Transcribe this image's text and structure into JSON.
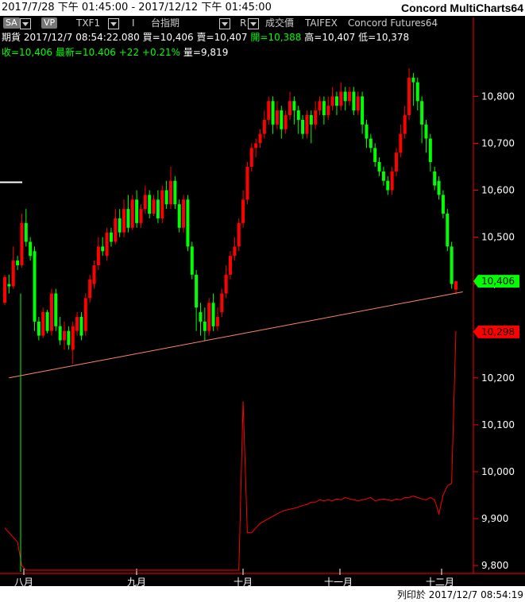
{
  "window": {
    "date_range": "2017/7/28 下午 01:45:00 - 2017/12/12 下午 01:45:00",
    "brand": "Concord MultiCharts64"
  },
  "toolbar": {
    "sa_label": "SA",
    "vp_label": "VP",
    "symbol": "TXF1",
    "interval_label": "I",
    "index_name": "台指期",
    "r_label": "R",
    "price_type": "成交價",
    "exchange": "TAIFEX",
    "feed": "Concord Futures64"
  },
  "quote": {
    "category": "期貨",
    "timestamp": "2017/12/7  08:54:22.080",
    "bid": "買=10,406",
    "ask": "賣=10,407",
    "open": "開=10,388",
    "high": "高=10,407",
    "low": "低=10,378",
    "close": "收=10,406",
    "last": "最新=10.406",
    "change": "+22",
    "change_pct": "+0.21%",
    "volume": "量=9,819"
  },
  "price_axis": {
    "ticks": [
      "10,800",
      "10,700",
      "10,600",
      "10,500",
      "10,400",
      "10,300",
      "10,200",
      "10,100",
      "10,000",
      "9,900",
      "9,800"
    ],
    "last_price_tag": "10,406",
    "second_tag": "10,298",
    "last_tag_color": "#00ff00",
    "second_tag_color": "#ff0000"
  },
  "time_axis": [
    "八月",
    "九月",
    "十月",
    "十一月",
    "十二月"
  ],
  "footer": {
    "printed": "列印於 2017/12/7 08:54:19"
  },
  "chart_data": {
    "type": "candlestick",
    "up_color": "#ff0000",
    "down_color": "#00ff00",
    "ylim": [
      9790,
      10870
    ],
    "candles": [
      [
        10360,
        10415,
        10355,
        10420
      ],
      [
        10400,
        10395,
        10380,
        10420
      ],
      [
        10395,
        10450,
        10390,
        10480
      ],
      [
        10450,
        10440,
        10430,
        10460
      ],
      [
        10440,
        10530,
        10435,
        10550
      ],
      [
        10530,
        10490,
        10480,
        10560
      ],
      [
        10490,
        10460,
        10450,
        10500
      ],
      [
        10470,
        10320,
        10300,
        10480
      ],
      [
        10320,
        10290,
        10280,
        10330
      ],
      [
        10290,
        10340,
        10285,
        10350
      ],
      [
        10340,
        10300,
        10295,
        10345
      ],
      [
        10300,
        10380,
        10290,
        10390
      ],
      [
        10380,
        10310,
        10300,
        10390
      ],
      [
        10310,
        10280,
        10270,
        10330
      ],
      [
        10280,
        10300,
        10260,
        10320
      ],
      [
        10300,
        10270,
        10260,
        10310
      ],
      [
        10260,
        10310,
        10230,
        10320
      ],
      [
        10300,
        10330,
        10290,
        10340
      ],
      [
        10330,
        10290,
        10280,
        10340
      ],
      [
        10300,
        10370,
        10290,
        10380
      ],
      [
        10370,
        10410,
        10360,
        10420
      ],
      [
        10400,
        10440,
        10390,
        10450
      ],
      [
        10440,
        10480,
        10430,
        10500
      ],
      [
        10480,
        10470,
        10460,
        10500
      ],
      [
        10460,
        10510,
        10450,
        10520
      ],
      [
        10510,
        10490,
        10480,
        10520
      ],
      [
        10490,
        10540,
        10485,
        10560
      ],
      [
        10540,
        10510,
        10500,
        10560
      ],
      [
        10510,
        10560,
        10500,
        10580
      ],
      [
        10560,
        10520,
        10510,
        10590
      ],
      [
        10520,
        10580,
        10515,
        10590
      ],
      [
        10580,
        10530,
        10520,
        10600
      ],
      [
        10530,
        10560,
        10520,
        10570
      ],
      [
        10560,
        10590,
        10550,
        10610
      ],
      [
        10590,
        10550,
        10540,
        10600
      ],
      [
        10550,
        10580,
        10545,
        10590
      ],
      [
        10580,
        10540,
        10530,
        10600
      ],
      [
        10540,
        10600,
        10530,
        10610
      ],
      [
        10600,
        10570,
        10560,
        10620
      ],
      [
        10570,
        10620,
        10560,
        10650
      ],
      [
        10620,
        10570,
        10560,
        10630
      ],
      [
        10570,
        10520,
        10510,
        10580
      ],
      [
        10520,
        10580,
        10510,
        10590
      ],
      [
        10580,
        10480,
        10470,
        10590
      ],
      [
        10480,
        10420,
        10410,
        10490
      ],
      [
        10420,
        10350,
        10300,
        10430
      ],
      [
        10340,
        10320,
        10290,
        10360
      ],
      [
        10320,
        10300,
        10280,
        10350
      ],
      [
        10300,
        10360,
        10290,
        10370
      ],
      [
        10360,
        10310,
        10300,
        10380
      ],
      [
        10310,
        10330,
        10300,
        10350
      ],
      [
        10340,
        10380,
        10330,
        10390
      ],
      [
        10380,
        10420,
        10370,
        10440
      ],
      [
        10420,
        10460,
        10410,
        10470
      ],
      [
        10460,
        10480,
        10450,
        10500
      ],
      [
        10480,
        10530,
        10470,
        10540
      ],
      [
        10530,
        10580,
        10520,
        10600
      ],
      [
        10580,
        10650,
        10570,
        10660
      ],
      [
        10650,
        10690,
        10640,
        10700
      ],
      [
        10690,
        10700,
        10670,
        10710
      ],
      [
        10700,
        10720,
        10690,
        10730
      ],
      [
        10720,
        10750,
        10710,
        10770
      ],
      [
        10750,
        10790,
        10740,
        10800
      ],
      [
        10790,
        10740,
        10720,
        10800
      ],
      [
        10740,
        10770,
        10730,
        10790
      ],
      [
        10770,
        10730,
        10710,
        10780
      ],
      [
        10730,
        10760,
        10720,
        10770
      ],
      [
        10760,
        10790,
        10750,
        10810
      ],
      [
        10790,
        10770,
        10740,
        10800
      ],
      [
        10770,
        10750,
        10720,
        10780
      ],
      [
        10750,
        10720,
        10710,
        10760
      ],
      [
        10720,
        10760,
        10710,
        10770
      ],
      [
        10760,
        10740,
        10700,
        10770
      ],
      [
        10740,
        10770,
        10730,
        10790
      ],
      [
        10770,
        10790,
        10760,
        10800
      ],
      [
        10790,
        10760,
        10740,
        10800
      ],
      [
        10760,
        10780,
        10750,
        10800
      ],
      [
        10780,
        10800,
        10770,
        10820
      ],
      [
        10800,
        10780,
        10760,
        10810
      ],
      [
        10780,
        10810,
        10770,
        10830
      ],
      [
        10810,
        10790,
        10770,
        10820
      ],
      [
        10790,
        10810,
        10780,
        10820
      ],
      [
        10810,
        10770,
        10760,
        10820
      ],
      [
        10770,
        10800,
        10760,
        10810
      ],
      [
        10800,
        10740,
        10720,
        10810
      ],
      [
        10740,
        10710,
        10690,
        10750
      ],
      [
        10710,
        10690,
        10680,
        10720
      ],
      [
        10690,
        10660,
        10650,
        10700
      ],
      [
        10660,
        10640,
        10630,
        10670
      ],
      [
        10640,
        10620,
        10610,
        10650
      ],
      [
        10620,
        10600,
        10590,
        10630
      ],
      [
        10600,
        10640,
        10590,
        10650
      ],
      [
        10640,
        10680,
        10630,
        10690
      ],
      [
        10680,
        10720,
        10670,
        10740
      ],
      [
        10720,
        10760,
        10710,
        10780
      ],
      [
        10760,
        10840,
        10750,
        10860
      ],
      [
        10840,
        10830,
        10780,
        10850
      ],
      [
        10830,
        10790,
        10770,
        10840
      ],
      [
        10790,
        10740,
        10700,
        10800
      ],
      [
        10740,
        10710,
        10680,
        10750
      ],
      [
        10710,
        10660,
        10640,
        10720
      ],
      [
        10640,
        10610,
        10600,
        10650
      ],
      [
        10620,
        10590,
        10580,
        10630
      ],
      [
        10590,
        10550,
        10540,
        10600
      ],
      [
        10550,
        10480,
        10470,
        10560
      ],
      [
        10480,
        10400,
        10390,
        10490
      ],
      [
        10388,
        10406,
        10378,
        10407
      ]
    ],
    "trendline": {
      "from": [
        1,
        10200
      ],
      "to": [
        105,
        10380
      ]
    },
    "indicator": {
      "values": [
        9880,
        9870,
        9860,
        9850,
        9800,
        9790,
        9790,
        9790,
        9790,
        9790,
        9790,
        9790,
        9790,
        9790,
        9790,
        9790,
        9790,
        9790,
        9790,
        9790,
        9790,
        9790,
        9790,
        9790,
        9790,
        9790,
        9790,
        9790,
        9790,
        9790,
        9790,
        9790,
        9790,
        9790,
        9790,
        9790,
        9790,
        9790,
        9790,
        9790,
        9790,
        9790,
        9790,
        9790,
        9790,
        9790,
        9790,
        9790,
        9790,
        9790,
        9790,
        9790,
        9790,
        9790,
        9790,
        9790,
        10150,
        9870,
        9870,
        9880,
        9890,
        9895,
        9900,
        9905,
        9910,
        9915,
        9918,
        9920,
        9922,
        9925,
        9928,
        9930,
        9935,
        9935,
        9940,
        9938,
        9940,
        9938,
        9942,
        9940,
        9945,
        9942,
        9940,
        9938,
        9940,
        9942,
        9945,
        9938,
        9940,
        9942,
        9940,
        9938,
        9942,
        9940,
        9945,
        9945,
        9948,
        9945,
        9942,
        9940,
        9945,
        9940,
        9910,
        9950,
        9970,
        9975,
        10300
      ],
      "color": "#ff0000"
    },
    "last_price": 10406,
    "second_value": 10298
  }
}
